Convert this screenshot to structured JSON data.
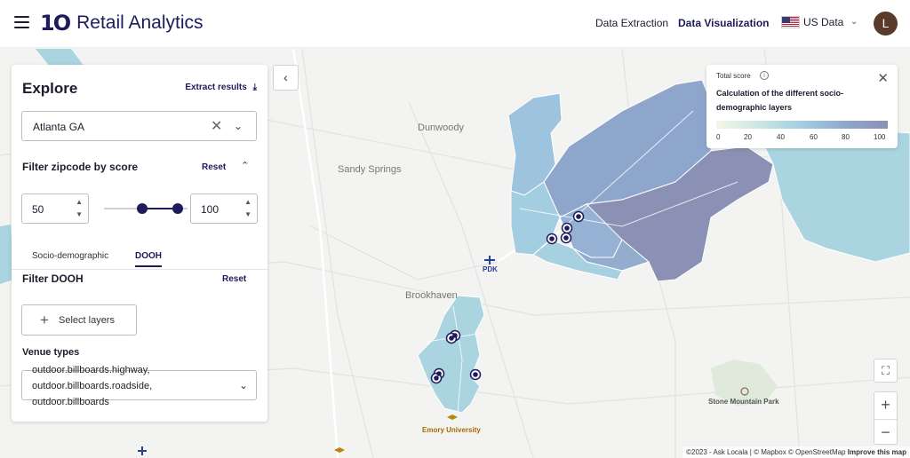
{
  "header": {
    "app_name": "Retail Analytics",
    "logo_mark": "1O",
    "nav": [
      "Data Extraction",
      "Data Visualization"
    ],
    "active_nav": "Data Visualization",
    "region_label": "US Data",
    "avatar_initial": "L"
  },
  "explore": {
    "title": "Explore",
    "extract_label": "Extract results",
    "location_value": "Atlanta GA",
    "filter_title": "Filter zipcode by score",
    "reset_label": "Reset",
    "score_min": "50",
    "score_max": "100",
    "tabs": [
      "Socio-demographic",
      "DOOH"
    ],
    "active_tab": "DOOH",
    "filter_dooh_title": "Filter DOOH",
    "select_layers_label": "Select layers",
    "venue_label": "Venue types",
    "venue_value": "outdoor.billboards.highway, outdoor.billboards.roadside, outdoor.billboards"
  },
  "legend": {
    "title": "Total score",
    "description": "Calculation of the different socio-demographic layers",
    "ticks": [
      "0",
      "20",
      "40",
      "60",
      "80",
      "100"
    ],
    "gradient_colors": [
      "#f3f7e6",
      "#cbe6e4",
      "#a3cde0",
      "#8fa7cd",
      "#8b91b4"
    ]
  },
  "map": {
    "labels": {
      "dunwoody": "Dunwoody",
      "sandy_springs": "Sandy Springs",
      "brookhaven": "Brookhaven",
      "pdk": "PDK",
      "emory": "Emory University",
      "stone_mountain": "Stone Mountain Park"
    },
    "attribution_prefix": "©2023 - Ask Locala | © Mapbox © OpenStreetMap",
    "attribution_link": "Improve this map"
  },
  "icons": {
    "menu": "hamburger-icon",
    "extract": "download-icon",
    "clear": "close-icon",
    "dropdown": "chevron-down-icon",
    "collapse": "chevron-left-icon",
    "fullscreen": "fullscreen-icon"
  }
}
